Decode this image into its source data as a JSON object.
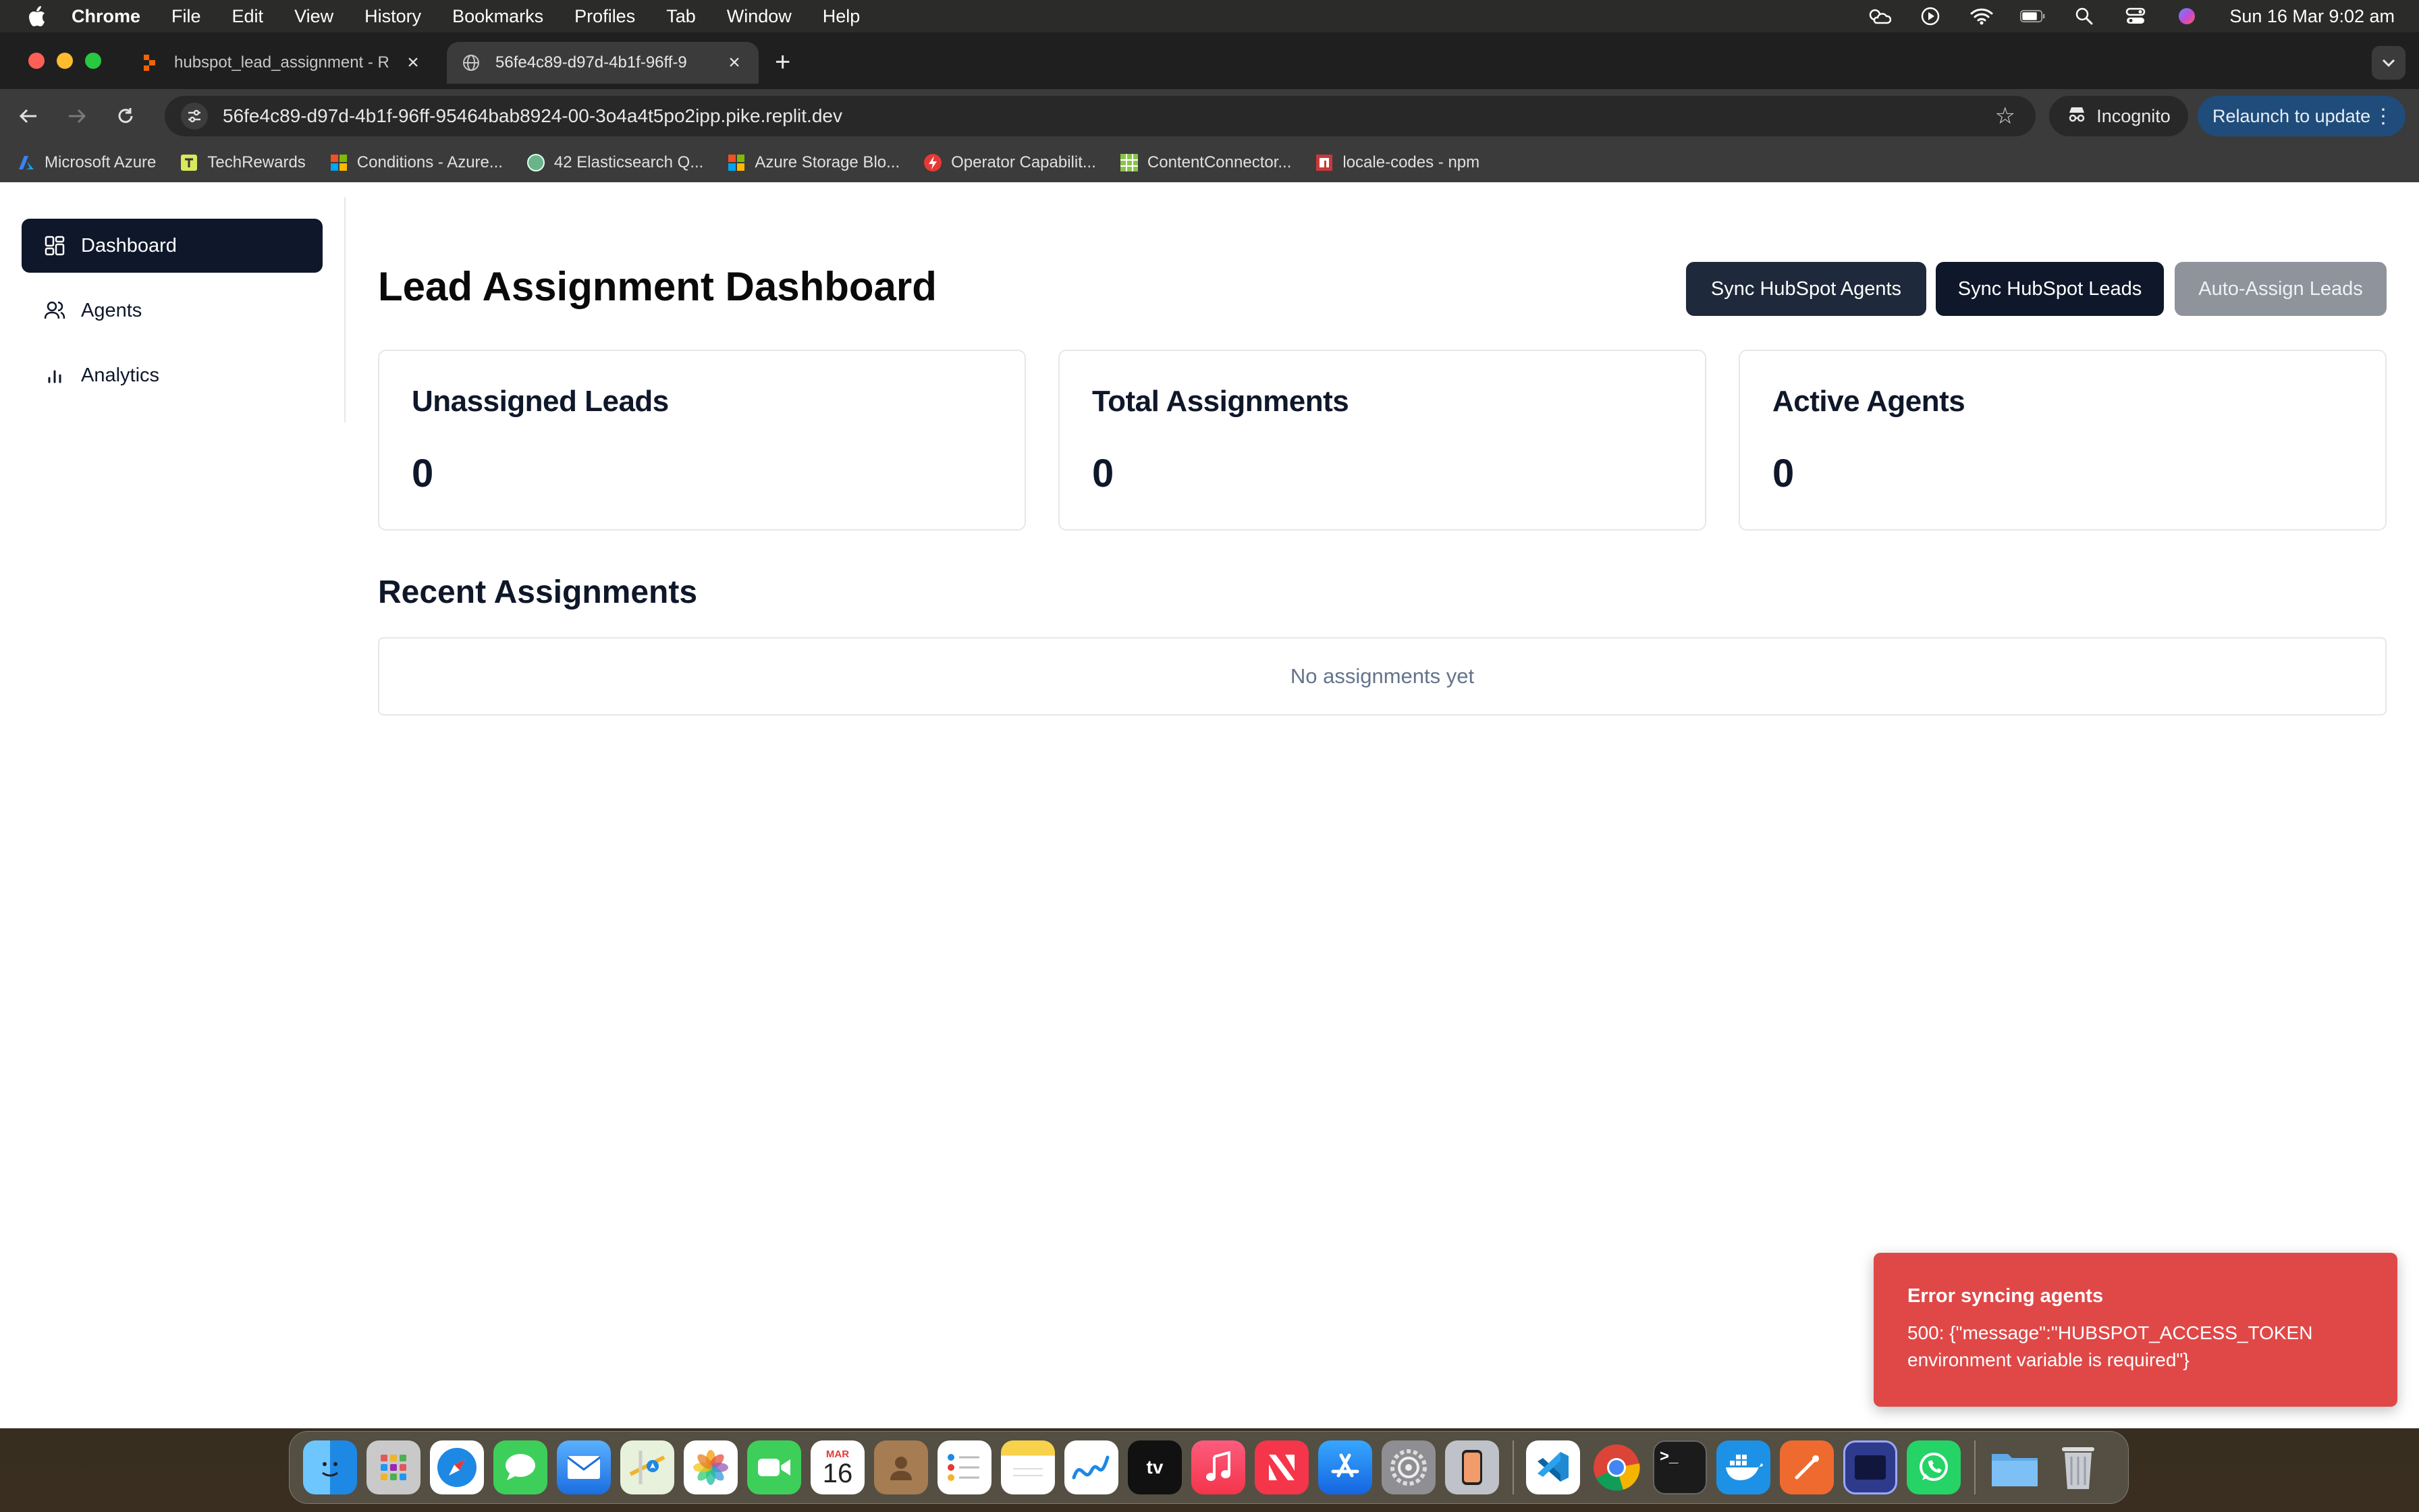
{
  "menubar": {
    "app": "Chrome",
    "items": [
      "File",
      "Edit",
      "View",
      "History",
      "Bookmarks",
      "Profiles",
      "Tab",
      "Window",
      "Help"
    ],
    "clock": "Sun 16 Mar  9:02 am"
  },
  "browser": {
    "tabs": [
      {
        "title": "hubspot_lead_assignment - R",
        "icon": "replit-icon"
      },
      {
        "title": "56fe4c89-d97d-4b1f-96ff-9",
        "icon": "globe-icon"
      }
    ],
    "url": "56fe4c89-d97d-4b1f-96ff-95464bab8924-00-3o4a4t5po2ipp.pike.replit.dev",
    "incognito_label": "Incognito",
    "relaunch_label": "Relaunch to update",
    "bookmarks": [
      {
        "label": "Microsoft Azure",
        "icon": "azure-icon"
      },
      {
        "label": "TechRewards",
        "icon": "techrewards-icon"
      },
      {
        "label": "Conditions - Azure...",
        "icon": "microsoft-icon"
      },
      {
        "label": "42 Elasticsearch Q...",
        "icon": "circle-icon"
      },
      {
        "label": "Azure Storage Blo...",
        "icon": "microsoft-icon"
      },
      {
        "label": "Operator Capabilit...",
        "icon": "bolt-icon"
      },
      {
        "label": "ContentConnector...",
        "icon": "grid-icon"
      },
      {
        "label": "locale-codes - npm",
        "icon": "npm-icon"
      }
    ]
  },
  "sidebar": {
    "items": [
      {
        "label": "Dashboard",
        "icon": "dashboard-icon"
      },
      {
        "label": "Agents",
        "icon": "users-icon"
      },
      {
        "label": "Analytics",
        "icon": "bar-chart-icon"
      }
    ]
  },
  "main": {
    "title": "Lead Assignment Dashboard",
    "buttons": {
      "sync_agents": "Sync HubSpot Agents",
      "sync_leads": "Sync HubSpot Leads",
      "auto_assign": "Auto-Assign Leads"
    },
    "cards": [
      {
        "title": "Unassigned Leads",
        "value": "0"
      },
      {
        "title": "Total Assignments",
        "value": "0"
      },
      {
        "title": "Active Agents",
        "value": "0"
      }
    ],
    "recent_title": "Recent Assignments",
    "empty_text": "No assignments yet"
  },
  "toast": {
    "title": "Error syncing agents",
    "message": "500: {\"message\":\"HUBSPOT_ACCESS_TOKEN environment variable is required\"}"
  },
  "dock": {
    "calendar_month": "MAR",
    "calendar_day": "16",
    "apps": [
      "finder",
      "launchpad",
      "safari",
      "messages",
      "mail",
      "maps",
      "photos",
      "facetime",
      "calendar",
      "contacts",
      "reminders",
      "notes",
      "freeform",
      "tv",
      "music",
      "news",
      "app-store",
      "system-settings",
      "iphone-mirroring",
      "vscode",
      "chrome",
      "terminal",
      "docker",
      "postman",
      "preview",
      "whatsapp",
      "downloads",
      "trash"
    ]
  },
  "colors": {
    "primary": "#0f172a",
    "toast_bg": "#e04848",
    "disabled_button": "#8e939c",
    "relaunch": "#1f4c7a"
  }
}
